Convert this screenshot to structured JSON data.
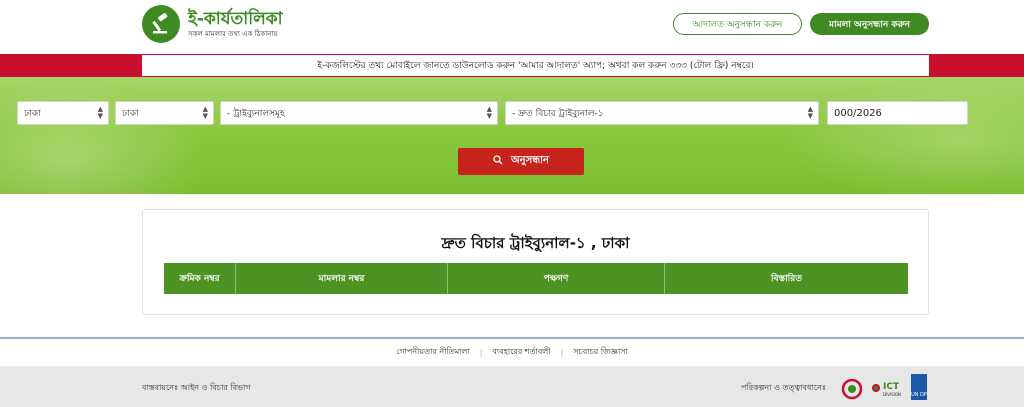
{
  "header": {
    "logo_title": "ই-কার্যতালিকা",
    "logo_subtitle": "সকল মামলার তথ্য এক ঠিকানায়",
    "court_search_label": "আদালত অনুসন্ধান করুন",
    "case_search_label": "মামলা অনুসন্ধান করুন"
  },
  "notice": {
    "text": "ই-কজলিস্টের তথ্য মোবাইলে জানতে ডাউনলোড করুন 'আমার আদালত' অ্যাপ; অথবা কল করুন ৩৩৩ (টোল ফ্রি) নম্বরে।"
  },
  "filters": {
    "division": "ঢাকা",
    "district": "ঢাকা",
    "court_type": "- ট্রাইব্যুনালসমূহ",
    "court": "- দ্রুত বিচার ট্রাইব্যুনাল-১",
    "case_number": "000/2026",
    "search_label": "অনুসন্ধান"
  },
  "result": {
    "title": "দ্রুত বিচার ট্রাইব্যুনাল-১ , ঢাকা",
    "columns": [
      "ক্রমিক নম্বর",
      "মামলার নম্বর",
      "পক্ষগণ",
      "বিস্তারিত"
    ]
  },
  "footer_links": {
    "privacy": "গোপনীয়তার নীতিমালা",
    "terms": "ব্যবহারের শর্তাবলী",
    "faq": "সচরাচর জিজ্ঞাসা"
  },
  "footer": {
    "implementation": "বাস্তবায়নেঃ আইন ও বিচার বিভাগ",
    "planning": "পরিকল্পনা ও তত্ত্বাবধানেঃ",
    "ict_label": "ICT",
    "ict_sub": "DIVISION",
    "undp_label": "UN DP"
  },
  "colors": {
    "brand_green": "#3f8a22",
    "notice_red": "#c8102e",
    "search_red": "#c8221c",
    "table_header": "#4c9324"
  },
  "icons": {
    "logo": "gavel-icon",
    "search": "search-icon",
    "select_arrow": "updown-arrow-icon"
  }
}
